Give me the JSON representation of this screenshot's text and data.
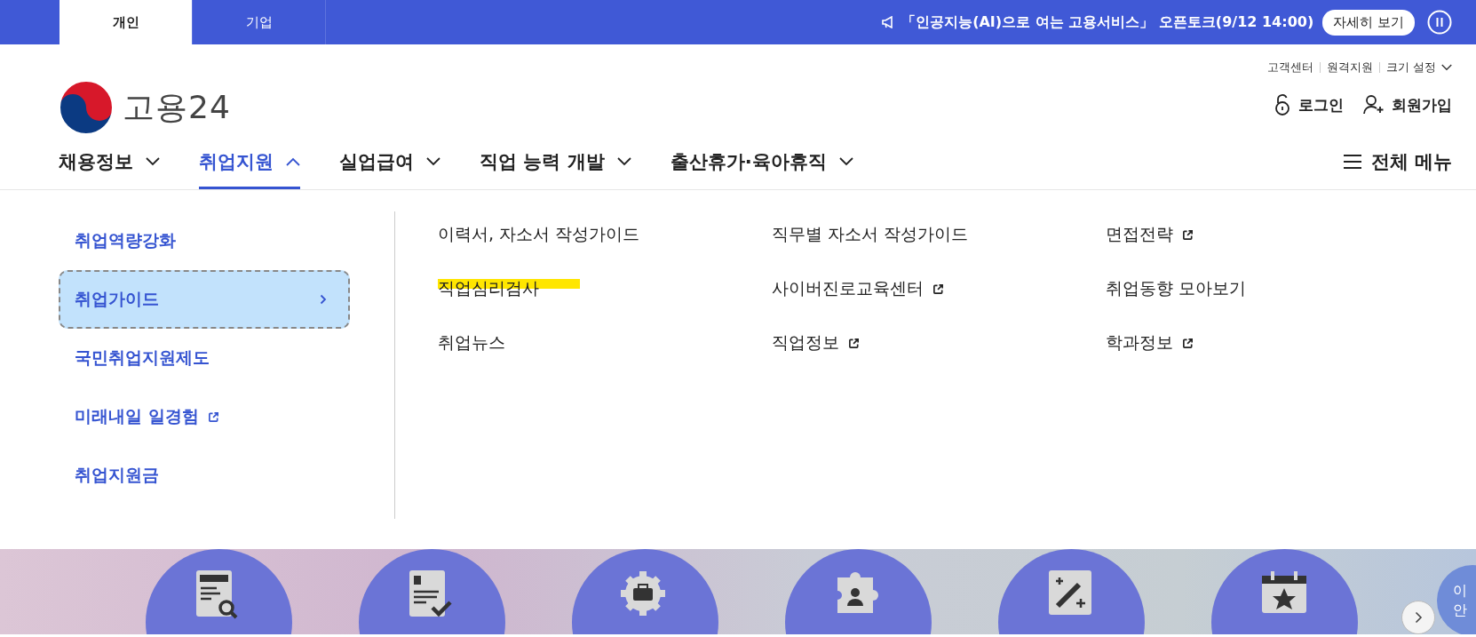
{
  "top_bar": {
    "tabs": [
      {
        "label": "개인",
        "selected": true
      },
      {
        "label": "기업",
        "selected": false
      }
    ],
    "notice": "「인공지능(AI)으로 여는 고용서비스」 오픈토크(9/12 14:00)",
    "notice_button": "자세히 보기"
  },
  "header": {
    "logo_text": "고용24",
    "utility_links": [
      "고객센터",
      "원격지원",
      "크기 설정"
    ],
    "account_links": [
      {
        "label": "로그인",
        "kind": "login"
      },
      {
        "label": "회원가입",
        "kind": "signup"
      }
    ]
  },
  "nav": {
    "items": [
      {
        "label": "채용정보",
        "expanded": false
      },
      {
        "label": "취업지원",
        "expanded": true
      },
      {
        "label": "실업급여",
        "expanded": false
      },
      {
        "label": "직업 능력 개발",
        "expanded": false
      },
      {
        "label": "출산휴가·육아휴직",
        "expanded": false
      }
    ],
    "all_menu": "전체 메뉴"
  },
  "mega_menu": {
    "categories": [
      {
        "label": "취업역량강화",
        "selected": false,
        "external": false
      },
      {
        "label": "취업가이드",
        "selected": true,
        "external": false
      },
      {
        "label": "국민취업지원제도",
        "selected": false,
        "external": false
      },
      {
        "label": "미래내일 일경험",
        "selected": false,
        "external": true
      },
      {
        "label": "취업지원금",
        "selected": false,
        "external": false
      }
    ],
    "links": [
      {
        "label": "이력서, 자소서 작성가이드",
        "external": false,
        "highlighted": false
      },
      {
        "label": "직무별 자소서 작성가이드",
        "external": false,
        "highlighted": false
      },
      {
        "label": "면접전략",
        "external": true,
        "highlighted": false
      },
      {
        "label": "직업심리검사",
        "external": false,
        "highlighted": true
      },
      {
        "label": "사이버진로교육센터",
        "external": true,
        "highlighted": false
      },
      {
        "label": "취업동향 모아보기",
        "external": false,
        "highlighted": false
      },
      {
        "label": "취업뉴스",
        "external": false,
        "highlighted": false
      },
      {
        "label": "직업정보",
        "external": true,
        "highlighted": false
      },
      {
        "label": "학과정보",
        "external": true,
        "highlighted": false
      }
    ]
  },
  "quick_links": {
    "side_badge_lines": [
      "이",
      "안"
    ]
  }
}
